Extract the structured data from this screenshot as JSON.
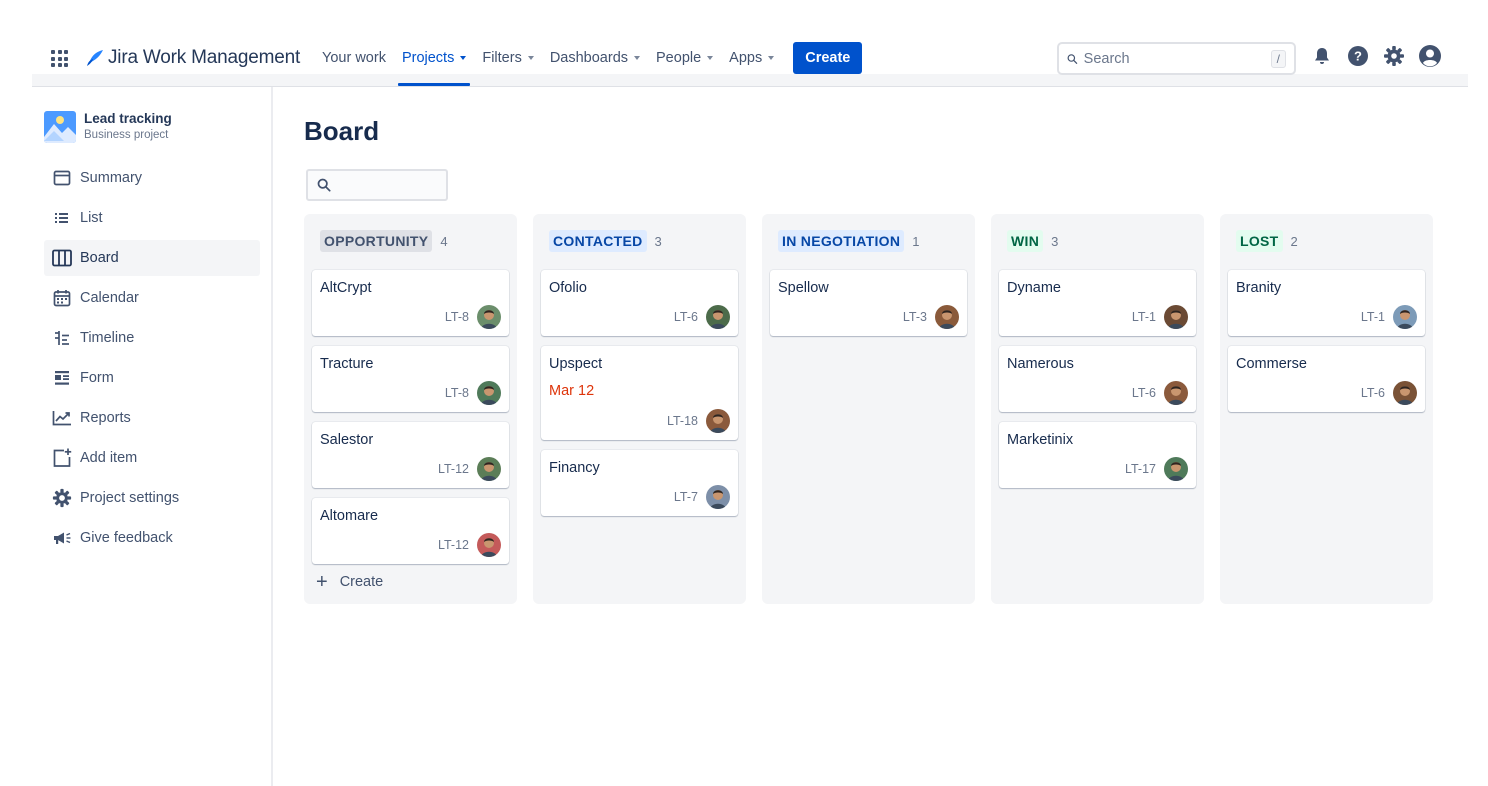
{
  "topnav": {
    "logo_text": "Jira Work Management",
    "items": [
      {
        "label": "Your work",
        "dropdown": false,
        "active": false
      },
      {
        "label": "Projects",
        "dropdown": true,
        "active": true
      },
      {
        "label": "Filters",
        "dropdown": true,
        "active": false
      },
      {
        "label": "Dashboards",
        "dropdown": true,
        "active": false
      },
      {
        "label": "People",
        "dropdown": true,
        "active": false
      },
      {
        "label": "Apps",
        "dropdown": true,
        "active": false
      }
    ],
    "create_label": "Create",
    "search_placeholder": "Search",
    "search_shortcut": "/",
    "icons": [
      "notifications-icon",
      "help-icon",
      "settings-icon",
      "profile-icon"
    ]
  },
  "sidebar": {
    "project_name": "Lead tracking",
    "project_type": "Business project",
    "items": [
      {
        "label": "Summary",
        "icon": "summary-icon",
        "active": false
      },
      {
        "label": "List",
        "icon": "list-icon",
        "active": false
      },
      {
        "label": "Board",
        "icon": "board-icon",
        "active": true
      },
      {
        "label": "Calendar",
        "icon": "calendar-icon",
        "active": false
      },
      {
        "label": "Timeline",
        "icon": "timeline-icon",
        "active": false
      },
      {
        "label": "Form",
        "icon": "form-icon",
        "active": false
      },
      {
        "label": "Reports",
        "icon": "reports-icon",
        "active": false
      },
      {
        "label": "Add item",
        "icon": "add-item-icon",
        "active": false
      },
      {
        "label": "Project settings",
        "icon": "gear-icon",
        "active": false
      },
      {
        "label": "Give feedback",
        "icon": "megaphone-icon",
        "active": false
      }
    ]
  },
  "main": {
    "title": "Board",
    "search_placeholder": "",
    "columns": [
      {
        "name": "OPPORTUNITY",
        "count": "4",
        "style": "grey",
        "cards": [
          {
            "title": "AltCrypt",
            "key": "LT-8",
            "date": "",
            "avatar": "#6b8e6b"
          },
          {
            "title": "Tracture",
            "key": "LT-8",
            "date": "",
            "avatar": "#4f7a5a"
          },
          {
            "title": "Salestor",
            "key": "LT-12",
            "date": "",
            "avatar": "#5b7d57"
          },
          {
            "title": "Altomare",
            "key": "LT-12",
            "date": "",
            "avatar": "#c45a5a"
          }
        ],
        "create_label": "Create"
      },
      {
        "name": "CONTACTED",
        "count": "3",
        "style": "blue",
        "cards": [
          {
            "title": "Ofolio",
            "key": "LT-6",
            "date": "",
            "avatar": "#4c6b4a"
          },
          {
            "title": "Upspect",
            "key": "LT-18",
            "date": "Mar 12",
            "avatar": "#8b5a3c"
          },
          {
            "title": "Financy",
            "key": "LT-7",
            "date": "",
            "avatar": "#7d8fa8"
          }
        ]
      },
      {
        "name": "IN NEGOTIATION",
        "count": "1",
        "style": "blue",
        "cards": [
          {
            "title": "Spellow",
            "key": "LT-3",
            "date": "",
            "avatar": "#8a5a3a"
          }
        ]
      },
      {
        "name": "WIN",
        "count": "3",
        "style": "green",
        "cards": [
          {
            "title": "Dyname",
            "key": "LT-1",
            "date": "",
            "avatar": "#6b4a34"
          },
          {
            "title": "Namerous",
            "key": "LT-6",
            "date": "",
            "avatar": "#8b5a3c"
          },
          {
            "title": "Marketinix",
            "key": "LT-17",
            "date": "",
            "avatar": "#4f7a5a"
          }
        ]
      },
      {
        "name": "LOST",
        "count": "2",
        "style": "green",
        "cards": [
          {
            "title": "Branity",
            "key": "LT-1",
            "date": "",
            "avatar": "#7d9bb8"
          },
          {
            "title": "Commerse",
            "key": "LT-6",
            "date": "",
            "avatar": "#7a5236"
          }
        ]
      }
    ]
  }
}
